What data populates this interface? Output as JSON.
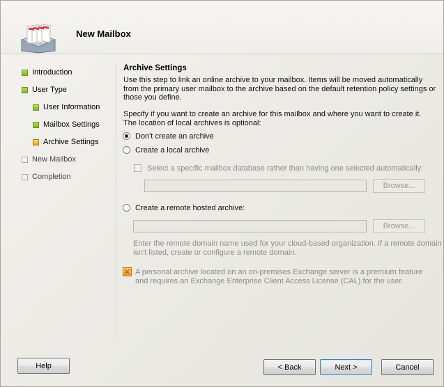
{
  "header": {
    "title": "New Mailbox"
  },
  "nav": {
    "items": [
      {
        "label": "Introduction",
        "state": "done"
      },
      {
        "label": "User Type",
        "state": "done"
      },
      {
        "label": "User Information",
        "state": "done"
      },
      {
        "label": "Mailbox Settings",
        "state": "done"
      },
      {
        "label": "Archive Settings",
        "state": "current"
      },
      {
        "label": "New Mailbox",
        "state": "todo"
      },
      {
        "label": "Completion",
        "state": "todo"
      }
    ]
  },
  "main": {
    "section_title": "Archive Settings",
    "intro": [
      "Use this step to link an online archive to your mailbox. Items will be moved automatically",
      "from the primary user mailbox to the archive based on the default retention policy settings or",
      "those you define."
    ],
    "specify": [
      "Specify if you want to create an archive for this mailbox and where you want to create it.",
      "The location of local archives is optional:"
    ],
    "options": {
      "none": "Don't create an archive",
      "local": "Create a local archive",
      "remote": "Create a remote hosted archive:"
    },
    "selected_option": "none",
    "local_db_checkbox": "Select a specific mailbox database rather than having one selected automatically:",
    "local_db_value": "",
    "remote_domain_value": "",
    "browse_label": "Browse...",
    "remote_hint": [
      "Enter the remote domain name used for your cloud-based organization. If a remote domain",
      "isn't listed, create or configure a remote domain."
    ],
    "notice": [
      "A personal archive located on an on-premises Exchange server is a premium feature",
      "and requires an Exchange Enterprise Client Access License (CAL) for the user."
    ]
  },
  "footer": {
    "help": "Help",
    "back": "< Back",
    "next": "Next >",
    "cancel": "Cancel"
  },
  "colors": {
    "step_done": "#7fb81e",
    "step_current": "#e9a915",
    "default_button_border": "#3c7fb1"
  }
}
